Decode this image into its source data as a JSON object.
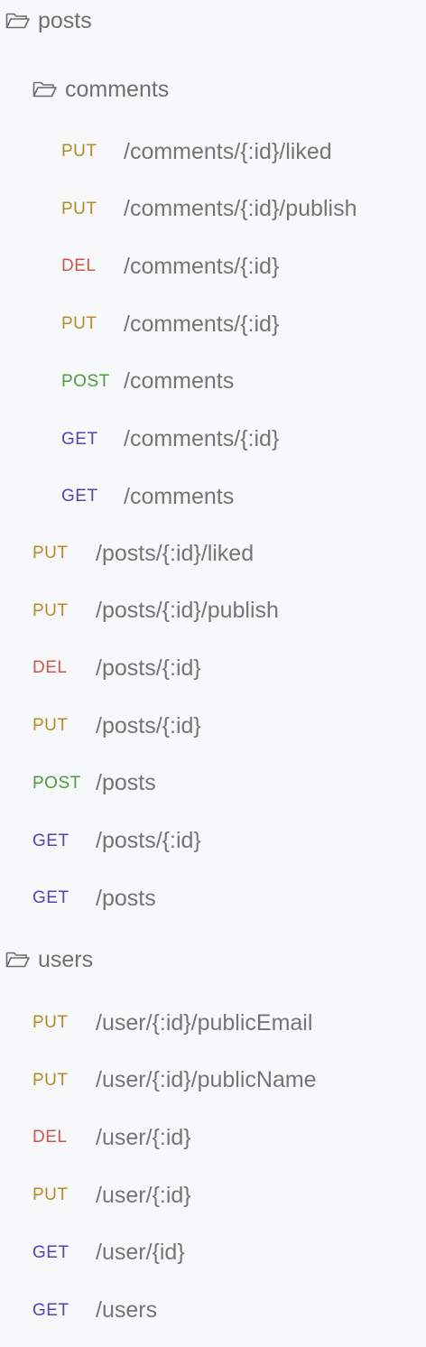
{
  "folders": {
    "posts": "posts",
    "comments": "comments",
    "users": "users"
  },
  "comments_endpoints": [
    {
      "method": "PUT",
      "path": "/comments/{:id}/liked"
    },
    {
      "method": "PUT",
      "path": "/comments/{:id}/publish"
    },
    {
      "method": "DEL",
      "path": "/comments/{:id}"
    },
    {
      "method": "PUT",
      "path": "/comments/{:id}"
    },
    {
      "method": "POST",
      "path": "/comments"
    },
    {
      "method": "GET",
      "path": "/comments/{:id}"
    },
    {
      "method": "GET",
      "path": "/comments"
    }
  ],
  "posts_endpoints": [
    {
      "method": "PUT",
      "path": "/posts/{:id}/liked"
    },
    {
      "method": "PUT",
      "path": "/posts/{:id}/publish"
    },
    {
      "method": "DEL",
      "path": "/posts/{:id}"
    },
    {
      "method": "PUT",
      "path": "/posts/{:id}"
    },
    {
      "method": "POST",
      "path": "/posts"
    },
    {
      "method": "GET",
      "path": "/posts/{:id}"
    },
    {
      "method": "GET",
      "path": "/posts"
    }
  ],
  "users_endpoints": [
    {
      "method": "PUT",
      "path": "/user/{:id}/publicEmail"
    },
    {
      "method": "PUT",
      "path": "/user/{:id}/publicName"
    },
    {
      "method": "DEL",
      "path": "/user/{:id}"
    },
    {
      "method": "PUT",
      "path": "/user/{:id}"
    },
    {
      "method": "GET",
      "path": "/user/{id}"
    },
    {
      "method": "GET",
      "path": "/users"
    }
  ],
  "colors": {
    "PUT": "#b58b2a",
    "DEL": "#d0554b",
    "POST": "#4f9a3c",
    "GET": "#5a3fb8",
    "background": "#f7f8fa"
  },
  "icons": {
    "folder": "folder-open-icon"
  }
}
